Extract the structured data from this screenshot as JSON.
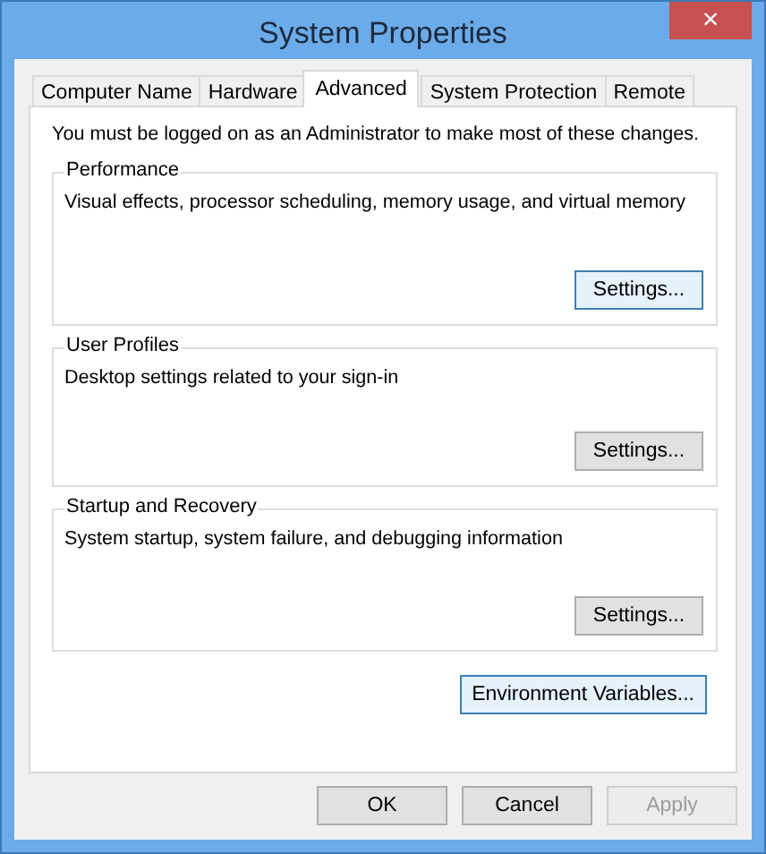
{
  "window": {
    "title": "System Properties",
    "close": "×"
  },
  "tabs": [
    {
      "label": "Computer Name",
      "selected": false
    },
    {
      "label": "Hardware",
      "selected": false
    },
    {
      "label": "Advanced",
      "selected": true
    },
    {
      "label": "System Protection",
      "selected": false
    },
    {
      "label": "Remote",
      "selected": false
    }
  ],
  "notice": "You must be logged on as an Administrator to make most of these changes.",
  "groups": [
    {
      "title": "Performance",
      "description": "Visual effects, processor scheduling, memory usage, and virtual memory",
      "button": {
        "label": "Settings...",
        "highlighted": true
      }
    },
    {
      "title": "User Profiles",
      "description": "Desktop settings related to your sign-in",
      "button": {
        "label": "Settings...",
        "highlighted": false
      }
    },
    {
      "title": "Startup and Recovery",
      "description": "System startup, system failure, and debugging information",
      "button": {
        "label": "Settings...",
        "highlighted": false
      }
    }
  ],
  "environment_button": {
    "label": "Environment Variables...",
    "highlighted": true
  },
  "buttons": [
    {
      "label": "OK",
      "disabled": false
    },
    {
      "label": "Cancel",
      "disabled": false
    },
    {
      "label": "Apply",
      "disabled": true
    }
  ]
}
